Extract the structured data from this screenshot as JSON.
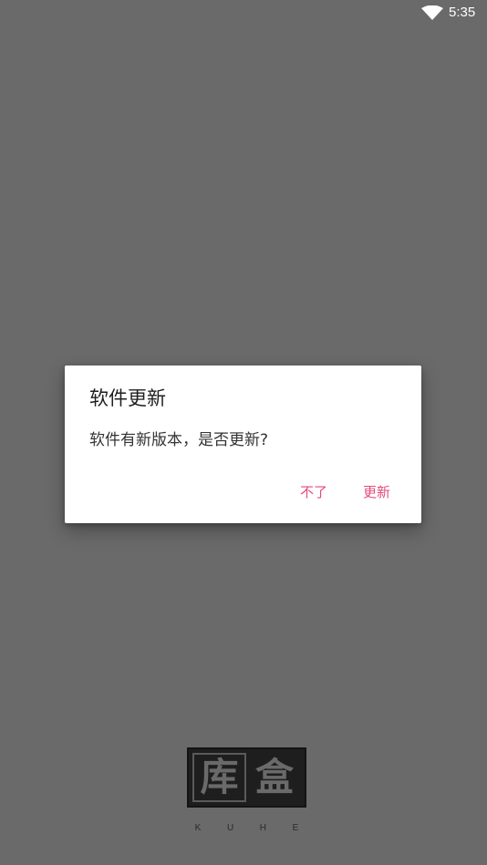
{
  "status_bar": {
    "time": "5:35",
    "wifi_icon": "wifi-icon"
  },
  "dialog": {
    "title": "软件更新",
    "message": "软件有新版本，是否更新?",
    "cancel_label": "不了",
    "confirm_label": "更新"
  },
  "logo": {
    "char_left": "库",
    "char_right": "盒",
    "letters": [
      "K",
      "U",
      "H",
      "E"
    ]
  },
  "colors": {
    "background": "#6a6a6a",
    "accent": "#e44b7b",
    "dialog_bg": "#ffffff"
  }
}
